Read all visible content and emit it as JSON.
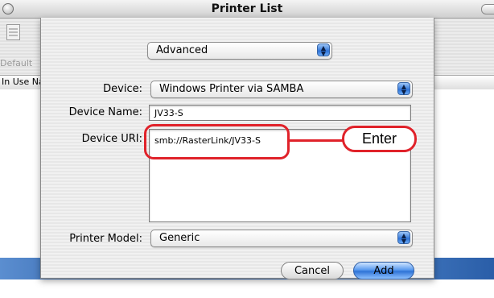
{
  "window": {
    "title": "Printer List"
  },
  "toolbar": {
    "default_label": "Default"
  },
  "list": {
    "columns": [
      "In Use",
      "Name"
    ]
  },
  "sheet": {
    "mode_popup": "Advanced",
    "device": {
      "label": "Device:",
      "value": "Windows Printer via SAMBA"
    },
    "device_name": {
      "label": "Device Name:",
      "value": "JV33-S"
    },
    "device_uri": {
      "label": "Device URI:",
      "value": "smb://RasterLink/JV33-S"
    },
    "printer_model": {
      "label": "Printer Model:",
      "value": "Generic"
    },
    "cancel_label": "Cancel",
    "add_label": "Add"
  },
  "annotation": {
    "callout_text": "Enter",
    "color": "#e0222a"
  },
  "colors": {
    "accent_button": "#2f73d6",
    "desktop": "#1e4f9a"
  },
  "icons": [
    "close-icon",
    "printer-icon",
    "popup-arrows-icon",
    "toolbar-toggle-icon"
  ]
}
